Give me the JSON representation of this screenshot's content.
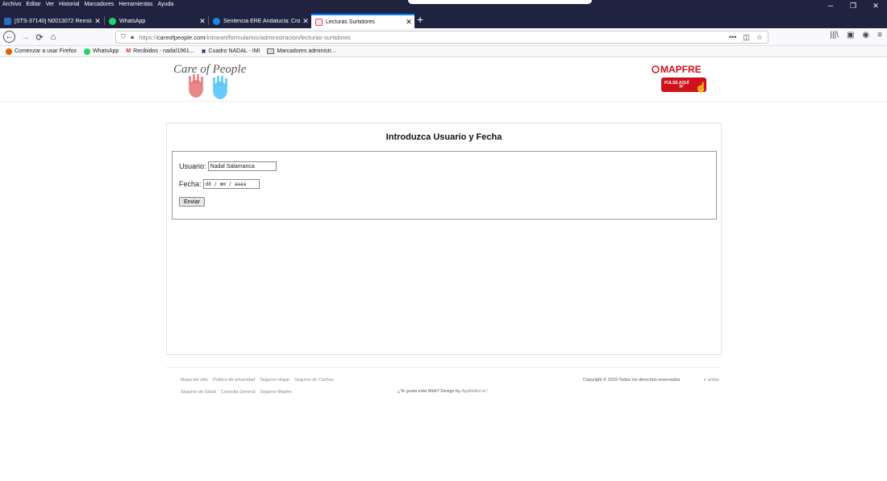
{
  "menu": [
    "Archivo",
    "Editar",
    "Ver",
    "Historial",
    "Marcadores",
    "Herramientas",
    "Ayuda"
  ],
  "tabs": [
    {
      "label": "[STS-37140] N0013072 Reinstal",
      "favicon_color": "#2a6ebb",
      "active": false
    },
    {
      "label": "WhatsApp",
      "favicon_color": "#25d366",
      "active": false
    },
    {
      "label": "Sentencia ERE Andalucía: Cron",
      "favicon_color": "#1e88e5",
      "active": false
    },
    {
      "label": "Lecturas Surtidores",
      "favicon_color": "#e84a6a",
      "active": true
    }
  ],
  "url": {
    "prefix": "https://",
    "domain": "careofpeople.com",
    "path": "/intranet/formularios/administracion/lecturas-surtidores"
  },
  "bookmarks": [
    {
      "label": "Comenzar a usar Firefox",
      "color": "#e66000"
    },
    {
      "label": "WhatsApp",
      "color": "#25d366"
    },
    {
      "label": "Recibidos - nadal1961...",
      "color": "#d93025"
    },
    {
      "label": "Cuadro NADAL - IMI",
      "color": "#1a237e"
    },
    {
      "label": "Marcadores administr...",
      "color": "#888888"
    }
  ],
  "logo": {
    "text": "Care of People"
  },
  "mapfre": {
    "brand": "MAPFRE",
    "cta": "PULSE AQUÍ"
  },
  "form": {
    "title": "Introduzca Usuario y Fecha",
    "usuario_label": "Usuario:",
    "usuario_value": "Nadal Salamanca",
    "fecha_label": "Fecha:",
    "fecha_placeholder": "dd / mm / aaaa",
    "submit": "Enviar"
  },
  "footer": {
    "links_row1": [
      "Mapa del sitio",
      "Política de privacidad",
      "Seguros Hogar",
      "Seguros de Coches"
    ],
    "links_row2": [
      "Seguros de Salud",
      "Consulta General",
      "Seguros Mapfre"
    ],
    "design_text": "¿Te gusta esta Web? Design by",
    "design_link": "Appillallorca !",
    "copyright": "Copyright © 2019 Todos los derechos reservados",
    "up_link": "∨ arriba"
  }
}
